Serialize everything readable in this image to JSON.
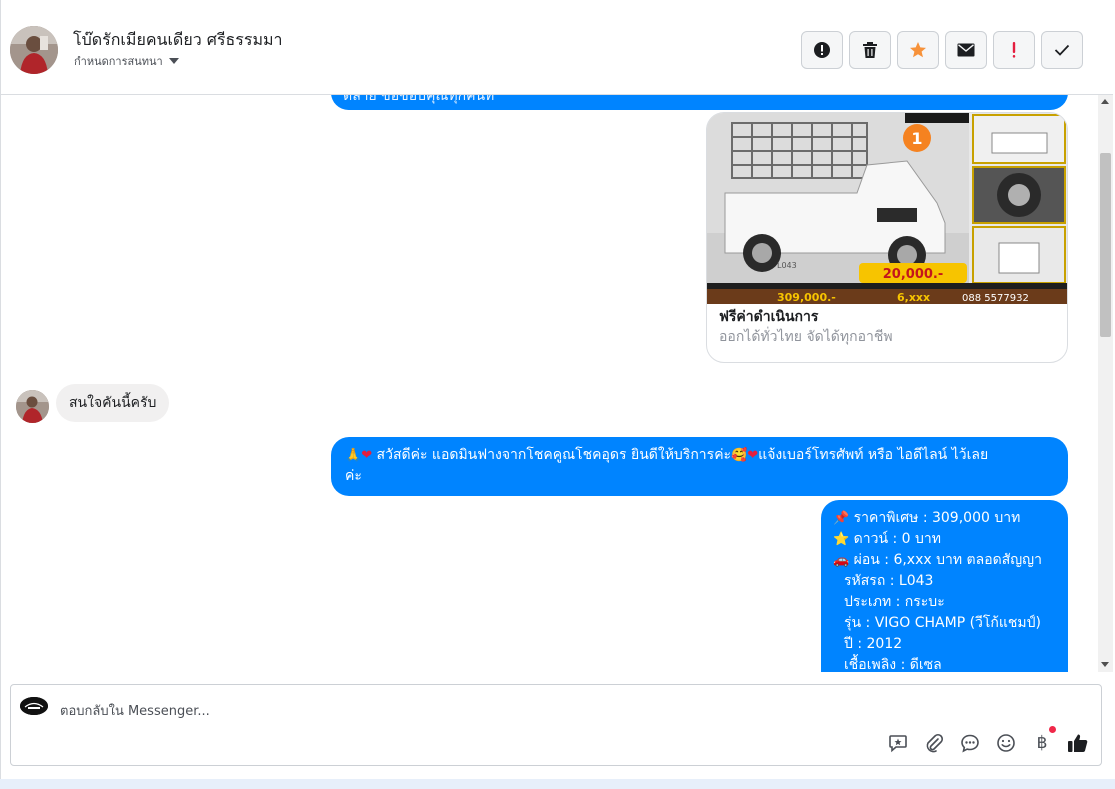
{
  "header": {
    "title": "โบ๊ดรักเมียคนเดียว ศรีธรรมมา",
    "subtitle": "กำหนดการสนทนา",
    "actions": [
      {
        "name": "report",
        "icon": "alert-circle-icon"
      },
      {
        "name": "delete",
        "icon": "trash-icon"
      },
      {
        "name": "star",
        "icon": "star-icon",
        "color": "#f7923a"
      },
      {
        "name": "mark-unread",
        "icon": "envelope-icon"
      },
      {
        "name": "spam",
        "icon": "exclamation-icon",
        "color": "#e41e3f"
      },
      {
        "name": "done",
        "icon": "check-icon"
      }
    ]
  },
  "messages": {
    "cut_off_text": "ตลาย ขอขอบคุณทุกคนท",
    "card": {
      "title": "ฟรีค่าดำเนินการ",
      "subtitle": "ออกได้ทั่วไทย จัดได้ทุกอาชีพ",
      "image": {
        "badge_price": "20,000.-",
        "price_label": "309,000.-",
        "installment": "6,xxx",
        "phone": "088 5577932",
        "code": "L043"
      }
    },
    "incoming": "สนใจคันนี้ครับ",
    "greeting_line1": "สวัสดีค่ะ แอดมินฟางจากโชคคูณโชคอุดร ยินดีให้บริการค่ะ",
    "greeting_line1b": "แจ้งเบอร์โทรศัพท์ หรือ ไอดีไลน์  ไว้เลย",
    "greeting_line2": "ค่ะ",
    "details": {
      "price": "ราคาพิเศษ : 309,000 บาท",
      "down": "ดาวน์ : 0 บาท",
      "installment": "ผ่อน : 6,xxx บาท ตลอดสัญญา",
      "code": "รหัสรถ : L043",
      "type": "ประเภท : กระบะ",
      "model": "รุ่น : VIGO CHAMP (วีโก้แชมป์)",
      "year": "ปี : 2012",
      "fuel": "เชื้อเพลิง : ดีเซล"
    }
  },
  "composer": {
    "placeholder": "ตอบกลับใน Messenger...",
    "icons": [
      "saved-reply-icon",
      "attachment-icon",
      "chat-bubble-icon",
      "emoji-icon",
      "baht-icon",
      "like-icon"
    ],
    "baht_symbol": "฿"
  }
}
